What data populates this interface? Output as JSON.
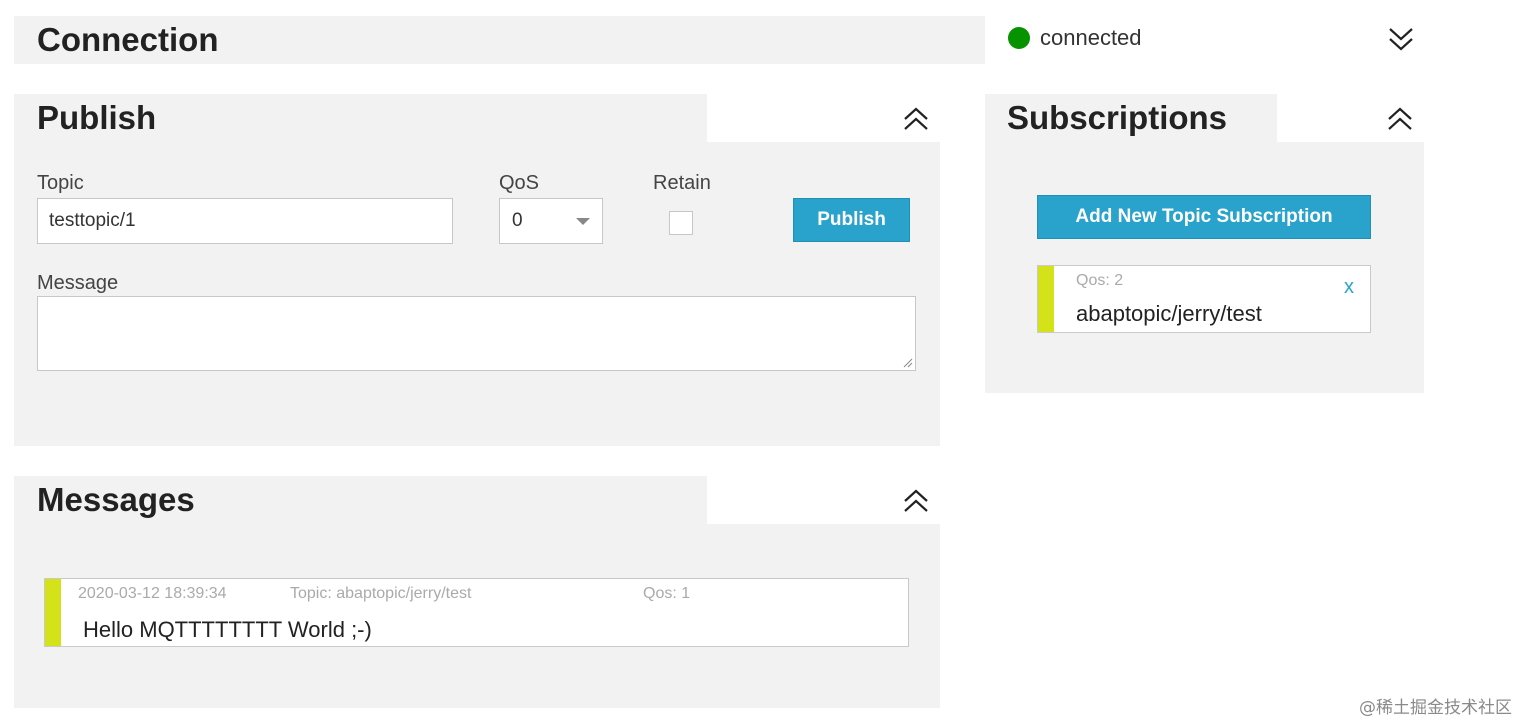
{
  "connection": {
    "title": "Connection",
    "status_text": "connected",
    "status_color": "#079200",
    "toggle_icon": "chevron-double-down-icon"
  },
  "publish": {
    "title": "Publish",
    "toggle_icon": "chevron-double-up-icon",
    "topic_label": "Topic",
    "topic_value": "testtopic/1",
    "qos_label": "QoS",
    "qos_value": "0",
    "retain_label": "Retain",
    "retain_checked": false,
    "publish_button": "Publish",
    "message_label": "Message",
    "message_value": ""
  },
  "subscriptions": {
    "title": "Subscriptions",
    "toggle_icon": "chevron-double-up-icon",
    "add_button": "Add New Topic Subscription",
    "items": [
      {
        "qos": "Qos: 2",
        "topic": "abaptopic/jerry/test",
        "remove": "x",
        "color": "#d4e319"
      }
    ]
  },
  "messages": {
    "title": "Messages",
    "toggle_icon": "chevron-double-up-icon",
    "items": [
      {
        "timestamp": "2020-03-12 18:39:34",
        "topic": "Topic: abaptopic/jerry/test",
        "qos": "Qos: 1",
        "payload": "Hello MQTTTTTTTT World ;-)",
        "color": "#d4e319"
      }
    ]
  },
  "watermark": "@稀土掘金技术社区",
  "accent_color": "#2aa3cc"
}
